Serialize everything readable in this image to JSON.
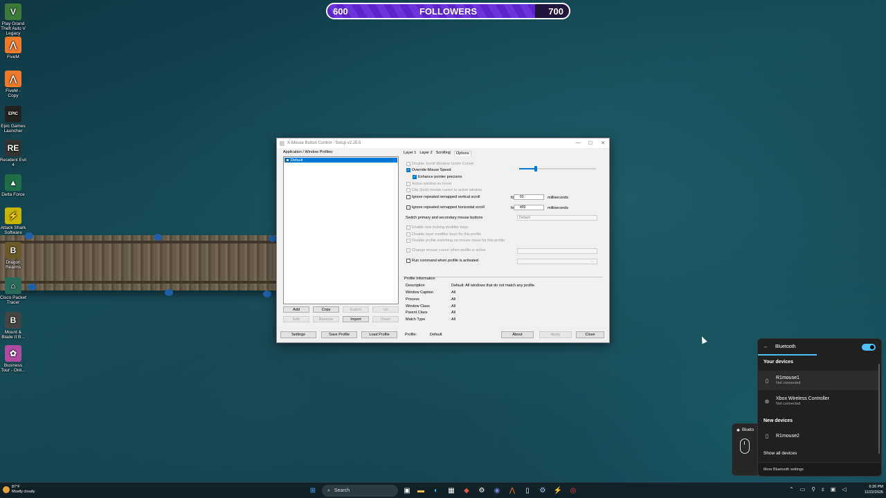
{
  "overlay": {
    "followers_start": "600",
    "followers_label": "FOLLOWERS",
    "followers_goal": "700",
    "progress_fraction": 0.86
  },
  "desktop_icons": [
    {
      "label": "Play Grand Theft Auto V Legacy",
      "icon": "gta-icon",
      "glyph": "V",
      "color": "#3b7a3b"
    },
    {
      "label": "FiveM",
      "icon": "fivem-icon",
      "glyph": "⋀",
      "color": "#f07a2a"
    },
    {
      "label": "FiveM - Copy",
      "icon": "fivem-copy-icon",
      "glyph": "⋀",
      "color": "#f07a2a"
    },
    {
      "label": "Epic Games Launcher",
      "icon": "epic-games-icon",
      "glyph": "EPIC",
      "color": "#222"
    },
    {
      "label": "Resident Evil 4",
      "icon": "resident-evil-icon",
      "glyph": "RE",
      "color": "#333"
    },
    {
      "label": "Delta Force",
      "icon": "delta-force-icon",
      "glyph": "▲",
      "color": "#1e6e4a"
    },
    {
      "label": "Attack Shark Software",
      "icon": "attack-shark-icon",
      "glyph": "⚡",
      "color": "#c9b400"
    },
    {
      "label": "Dragon Realms",
      "icon": "game-icon",
      "glyph": "B",
      "color": "#6a5a2a"
    },
    {
      "label": "Cisco Packet Tracer",
      "icon": "cisco-packet-tracer-icon",
      "glyph": "⌂",
      "color": "#2a6a5a"
    },
    {
      "label": "Mount & Blade II B...",
      "icon": "mount-blade-icon",
      "glyph": "B",
      "color": "#444"
    },
    {
      "label": "Business Tour - Onli...",
      "icon": "business-tour-icon",
      "glyph": "✿",
      "color": "#b04aa0"
    }
  ],
  "xmbc": {
    "title": "X-Mouse Button Control - Setup v2.20.5",
    "profiles_label": "Application / Window Profiles:",
    "profile_default": "Default",
    "list_buttons": {
      "add": "Add",
      "copy": "Copy",
      "export": "Export",
      "up": "Up",
      "edit": "Edit",
      "remove": "Remove",
      "import": "Import",
      "down": "Down"
    },
    "tabs": [
      "Layer 1",
      "Layer 2",
      "Scrolling",
      "Options"
    ],
    "options": {
      "disable_scroll": "Disable Scroll Window Under Cursor",
      "override_speed": "Override Mouse Speed",
      "enhance_precision": "Enhance pointer precision",
      "active_on_hover": "Active window on hover",
      "clip_cursor": "Clip (lock) mouse cursor to active window",
      "ignore_vertical": "Ignore repeated remapped vertical scroll",
      "ignore_horizontal": "Ignore repeated remapped horizontal scroll",
      "for": "for",
      "vertical_ms": "50",
      "horizontal_ms": "400",
      "milliseconds": "milliseconds",
      "switch_buttons": "Switch primary and secondary mouse buttons",
      "switch_value": "Default",
      "axis_locking": "Enable axis locking modifier keys",
      "disable_layer_modifier": "Disable layer modifier keys for this profile",
      "disable_profile_switching": "Disable profile switching on mouse move for this profile",
      "change_cursor": "Change mouse cursor when profile is active",
      "run_command": "Run command when profile is activated",
      "ellipsis": "..."
    },
    "profile_info": {
      "heading": "Profile Information",
      "rows": [
        {
          "key": "Description",
          "value": "Default: All windows that do not match any profile."
        },
        {
          "key": "Window Caption",
          "value": "All"
        },
        {
          "key": "Process",
          "value": "All"
        },
        {
          "key": "Window Class",
          "value": "All"
        },
        {
          "key": "Parent Class",
          "value": "All"
        },
        {
          "key": "Match Type",
          "value": "All"
        }
      ]
    },
    "bottom": {
      "settings": "Settings",
      "save_profile": "Save Profile",
      "load_profile": "Load Profile",
      "profile_label": "Profile:",
      "profile_value": "Default",
      "about": "About",
      "apply": "Apply",
      "close": "Close"
    }
  },
  "bluetooth": {
    "title": "Bluetooth",
    "your_devices": "Your devices",
    "devices": [
      {
        "name": "R1mouse1",
        "status": "Not connected",
        "icon": "mouse-icon"
      },
      {
        "name": "Xbox Wireless Controller",
        "status": "Not connected",
        "icon": "gamepad-icon"
      }
    ],
    "new_devices": "New devices",
    "new_device_name": "R1mouse2",
    "show_all": "Show all devices",
    "more_settings": "More Bluetooth settings",
    "toggle_on": true,
    "card_title": "Blueto"
  },
  "taskbar": {
    "weather_temp": "87°F",
    "weather_desc": "Mostly cloudy",
    "search_label": "Search",
    "time": "6:26 PM",
    "date": "11/22/2025"
  },
  "colors": {
    "accent": "#0078d7",
    "bt_accent": "#4cc2ff",
    "followers_fill": "#5b26c9"
  }
}
